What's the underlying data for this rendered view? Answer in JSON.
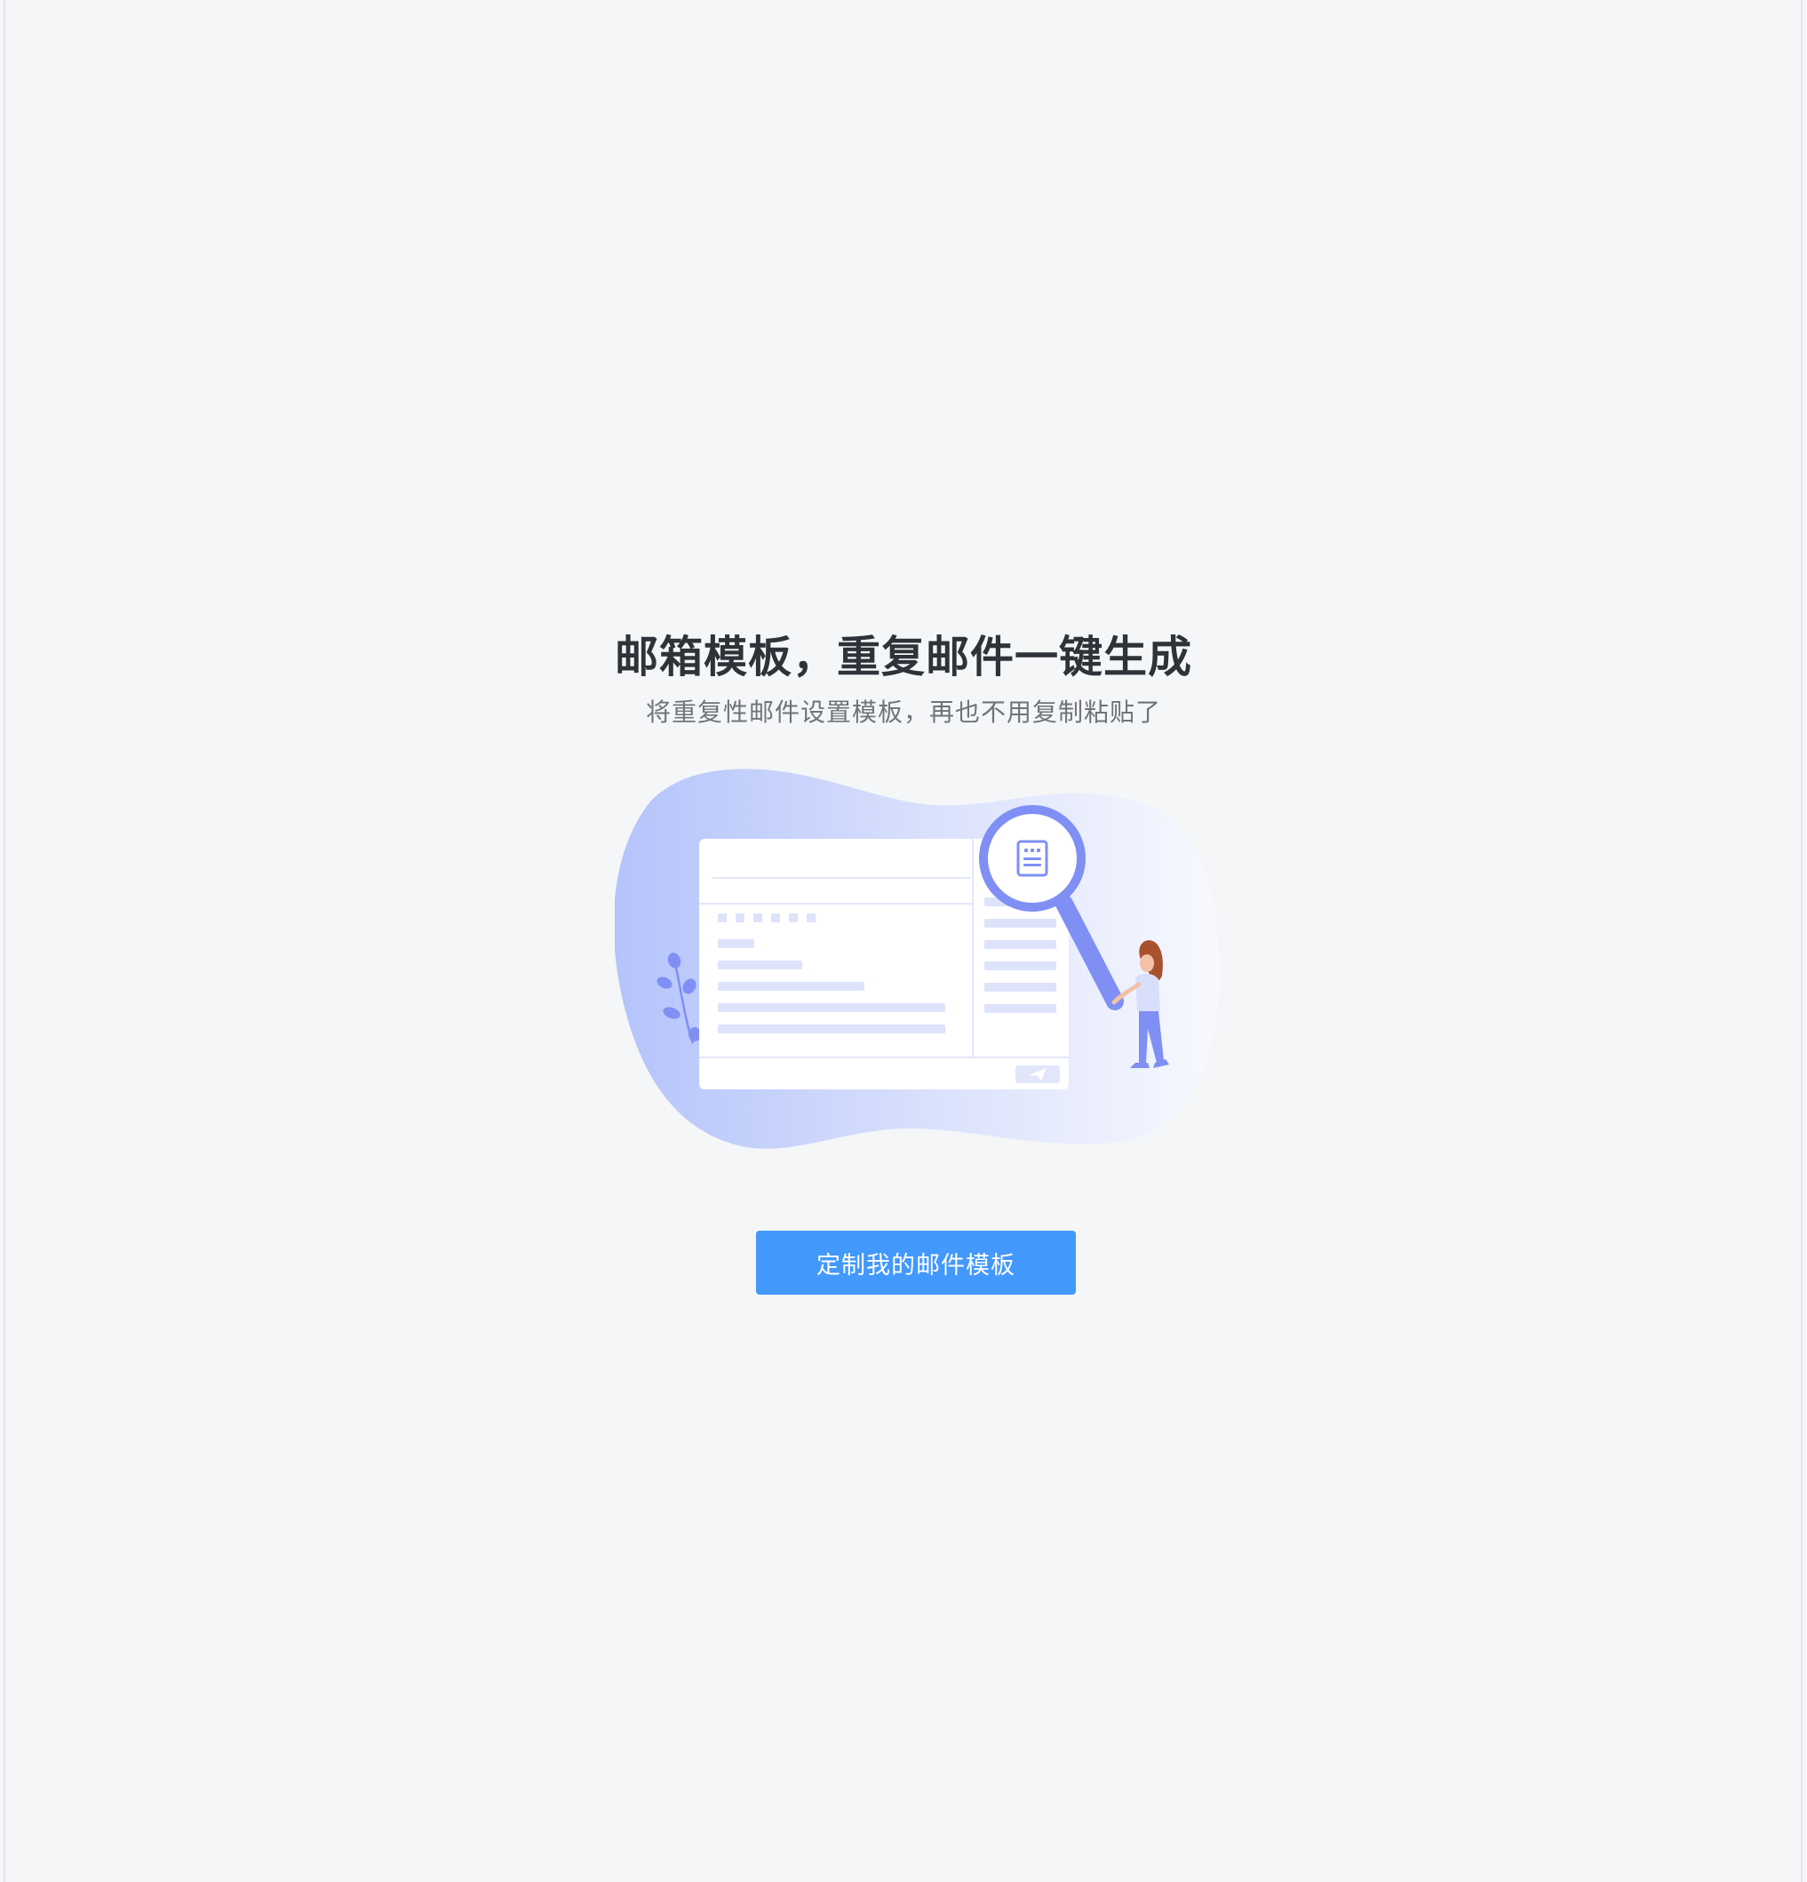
{
  "hero": {
    "title": "邮箱模板，重复邮件一键生成",
    "subtitle": "将重复性邮件设置模板，再也不用复制粘贴了",
    "cta_label": "定制我的邮件模板"
  },
  "illustration": {
    "icons": [
      "document-icon",
      "magnifier-icon",
      "send-icon",
      "person-figure",
      "plant-leaf"
    ]
  },
  "colors": {
    "background": "#f5f6f8",
    "title": "#2f3238",
    "subtitle": "#6f737a",
    "accent": "#4398fb",
    "illustration_primary": "#7f8ff4",
    "illustration_light": "#dde3fb"
  }
}
